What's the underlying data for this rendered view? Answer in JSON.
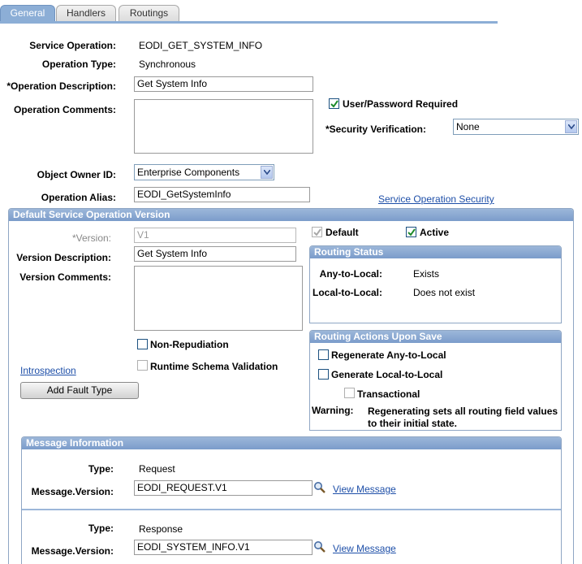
{
  "tabs": [
    {
      "label": "General"
    },
    {
      "label": "Handlers"
    },
    {
      "label": "Routings"
    }
  ],
  "general": {
    "service_operation_label": "Service Operation:",
    "service_operation_value": "EODI_GET_SYSTEM_INFO",
    "operation_type_label": "Operation Type:",
    "operation_type_value": "Synchronous",
    "operation_description_label": "*Operation Description:",
    "operation_description_value": "Get System Info",
    "operation_comments_label": "Operation Comments:",
    "user_password_label": "User/Password Required",
    "security_verification_label": "*Security Verification:",
    "security_verification_value": "None",
    "object_owner_label": "Object Owner ID:",
    "object_owner_value": "Enterprise Components",
    "operation_alias_label": "Operation Alias:",
    "operation_alias_value": "EODI_GetSystemInfo",
    "security_link": "Service Operation Security"
  },
  "version": {
    "header": "Default Service Operation Version",
    "version_label": "*Version:",
    "version_value": "V1",
    "default_label": "Default",
    "active_label": "Active",
    "version_description_label": "Version Description:",
    "version_description_value": "Get System Info",
    "version_comments_label": "Version Comments:",
    "non_repudiation_label": "Non-Repudiation",
    "runtime_schema_label": "Runtime Schema Validation",
    "introspection_link": "Introspection",
    "add_fault_button": "Add Fault Type"
  },
  "routing_status": {
    "header": "Routing Status",
    "any_to_local_label": "Any-to-Local:",
    "any_to_local_value": "Exists",
    "local_to_local_label": "Local-to-Local:",
    "local_to_local_value": "Does not exist"
  },
  "routing_actions": {
    "header": "Routing Actions Upon Save",
    "regen_any_label": "Regenerate Any-to-Local",
    "gen_local_label": "Generate Local-to-Local",
    "transactional_label": "Transactional",
    "warning_label": "Warning:",
    "warning_line1": "Regenerating sets all routing field values",
    "warning_line2": "to their initial state."
  },
  "message_info": {
    "header": "Message Information",
    "request_type_label": "Type:",
    "request_type_value": "Request",
    "request_msg_label": "Message.Version:",
    "request_msg_value": "EODI_REQUEST.V1",
    "request_view_link": "View Message",
    "response_type_label": "Type:",
    "response_type_value": "Response",
    "response_msg_label": "Message.Version:",
    "response_msg_value": "EODI_SYSTEM_INFO.V1",
    "response_view_link": "View Message"
  },
  "colors": {
    "group_header": "#7b9ccb",
    "link": "#1e4fa8",
    "tab_active": "#8caed6"
  }
}
